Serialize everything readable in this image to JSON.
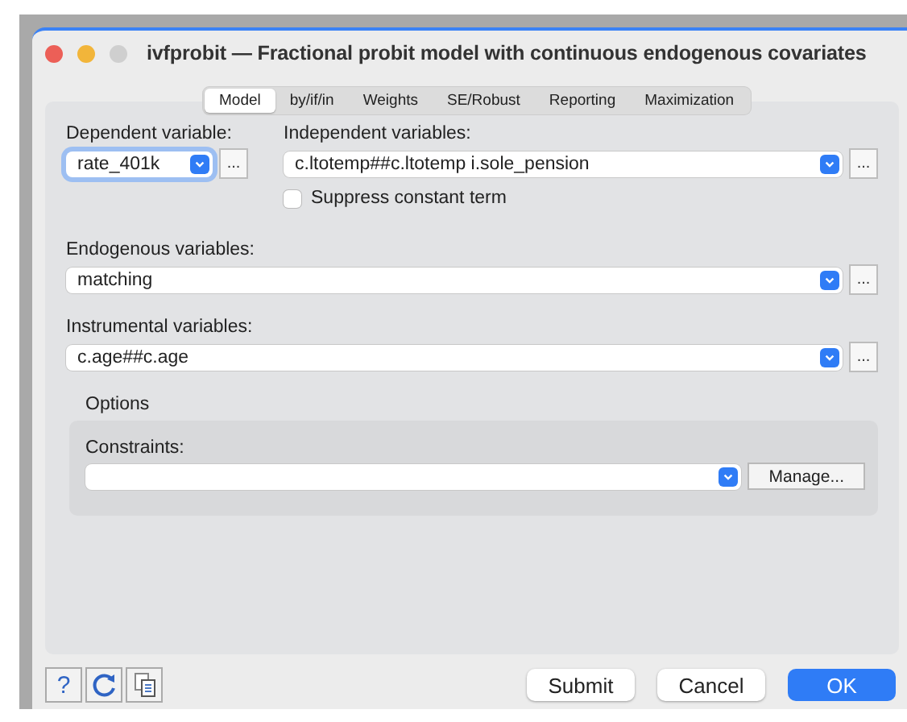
{
  "window": {
    "title": "ivfprobit — Fractional probit model with continuous endogenous covariates"
  },
  "tabs": [
    {
      "label": "Model",
      "selected": true
    },
    {
      "label": "by/if/in",
      "selected": false
    },
    {
      "label": "Weights",
      "selected": false
    },
    {
      "label": "SE/Robust",
      "selected": false
    },
    {
      "label": "Reporting",
      "selected": false
    },
    {
      "label": "Maximization",
      "selected": false
    }
  ],
  "dependent_variable": {
    "label": "Dependent variable:",
    "value": "rate_401k",
    "focused": true,
    "browse_button": "..."
  },
  "independent_variables": {
    "label": "Independent variables:",
    "value": "c.ltotemp##c.ltotemp i.sole_pension",
    "focused": false,
    "browse_button": "..."
  },
  "suppress_constant": {
    "label": "Suppress constant term",
    "checked": false
  },
  "endogenous_variables": {
    "label": "Endogenous variables:",
    "value": "matching",
    "focused": false,
    "browse_button": "..."
  },
  "instrumental_variables": {
    "label": "Instrumental variables:",
    "value": "c.age##c.age",
    "focused": false,
    "browse_button": "..."
  },
  "options": {
    "title": "Options",
    "constraints_label": "Constraints:",
    "manage_button": "Manage..."
  },
  "tool_buttons": [
    {
      "kind": "help",
      "label": "?"
    },
    {
      "kind": "reset"
    },
    {
      "kind": "copy"
    }
  ],
  "buttons": [
    {
      "label": "Submit",
      "primary": false
    },
    {
      "label": "Cancel",
      "primary": false
    },
    {
      "label": "OK",
      "primary": true
    }
  ]
}
